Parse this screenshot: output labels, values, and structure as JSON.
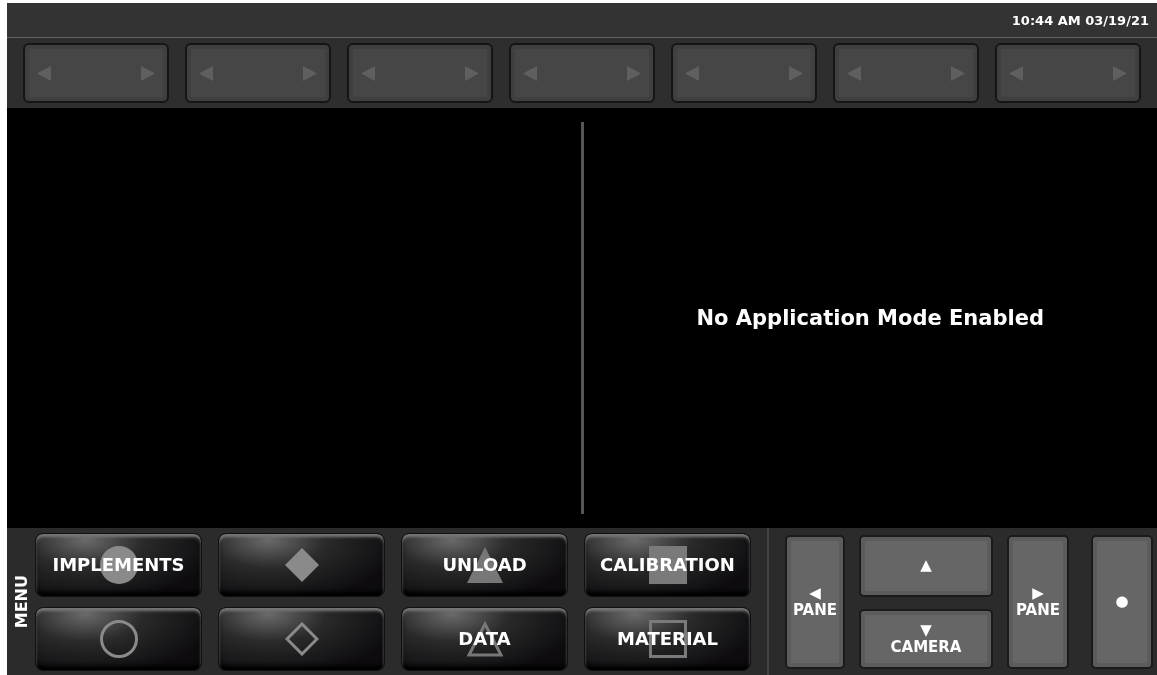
{
  "status_bar": {
    "clock": "10:44 AM 03/19/21"
  },
  "selectors": [
    {
      "kind": "empty"
    },
    {
      "kind": "empty"
    },
    {
      "kind": "empty"
    },
    {
      "kind": "empty"
    },
    {
      "kind": "empty"
    },
    {
      "kind": "empty"
    },
    {
      "kind": "empty"
    }
  ],
  "main": {
    "message": "No Application Mode Enabled"
  },
  "menu": {
    "title": "MENU",
    "buttons": [
      {
        "label": "IMPLEMENTS",
        "kind": "circle"
      },
      {
        "kind": "diamond"
      },
      {
        "label": "UNLOAD",
        "kind": "triangle"
      },
      {
        "label": "CALIBRATION",
        "kind": "square"
      },
      {
        "kind": "circle-outline"
      },
      {
        "kind": "diamond-outline"
      },
      {
        "label": "DATA",
        "kind": "triangle-outline"
      },
      {
        "label": "MATERIAL",
        "kind": "square-outline"
      }
    ]
  },
  "nav": {
    "pane_left": {
      "arrow": "◀",
      "label": "PANE"
    },
    "camera_up": {
      "arrow": "▲"
    },
    "camera_down": {
      "arrow": "▼",
      "label": "CAMERA"
    },
    "pane_right": {
      "arrow": "▶",
      "label": "PANE"
    },
    "record": {
      "symbol": "●"
    }
  }
}
